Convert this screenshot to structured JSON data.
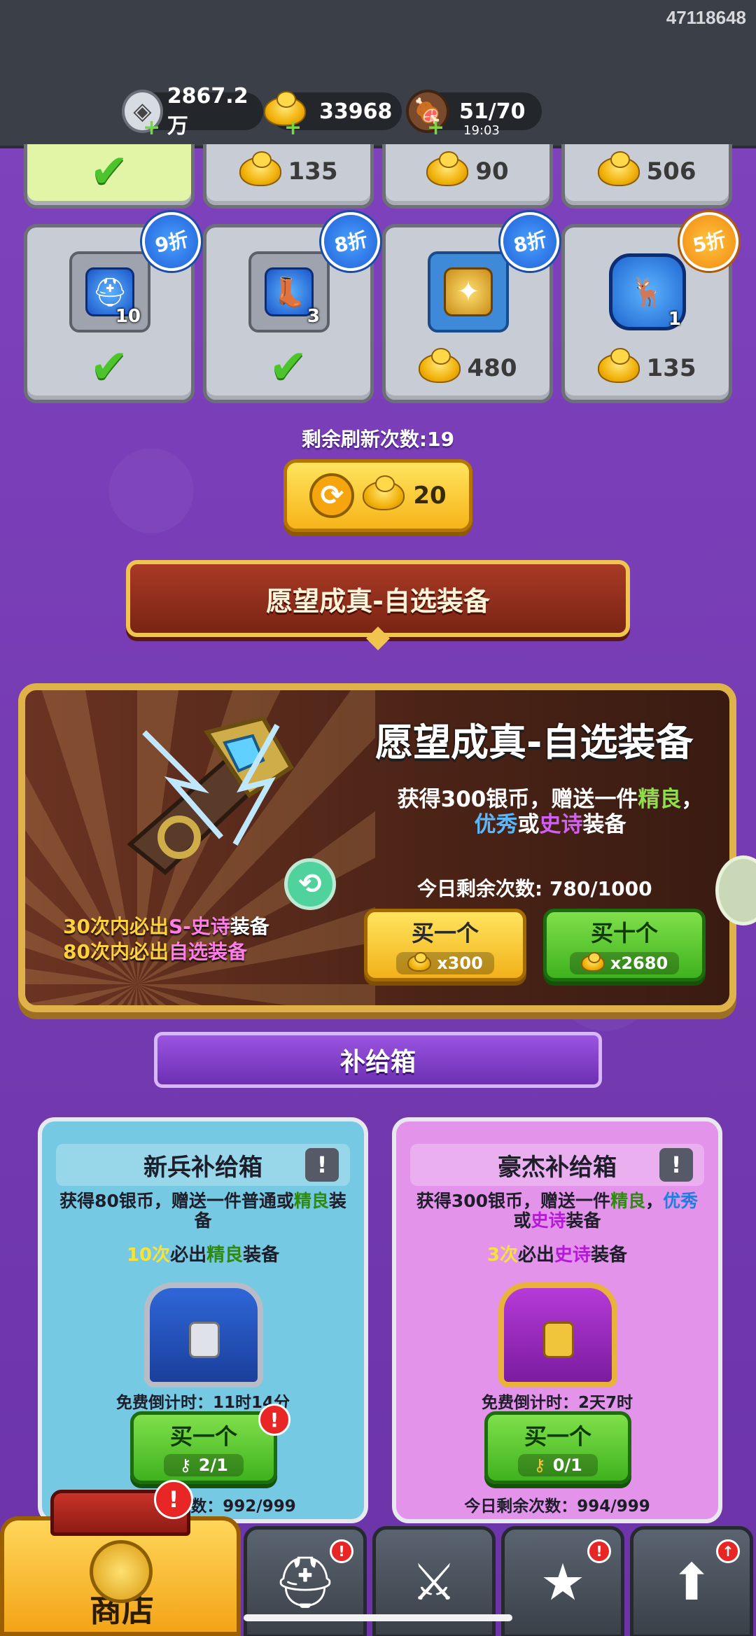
{
  "header": {
    "uid": "47118648",
    "silver": "2867.2万",
    "gold": "33968",
    "stamina": "51/70",
    "stamina_timer": "19:03"
  },
  "shop_row_top": [
    {
      "state": "purchased"
    },
    {
      "price": "135"
    },
    {
      "price": "90"
    },
    {
      "price": "506"
    }
  ],
  "shop_row_main": [
    {
      "discount": "9折",
      "count": "10",
      "icon": "helmet-icon",
      "state": "purchased"
    },
    {
      "discount": "8折",
      "count": "3",
      "icon": "boots-icon",
      "state": "purchased"
    },
    {
      "discount": "8折",
      "icon": "amulet-icon",
      "price": "480"
    },
    {
      "discount": "5折",
      "count": "1",
      "icon": "deer-emblem-icon",
      "price": "135"
    }
  ],
  "refresh": {
    "label": "剩余刷新次数:19",
    "cost": "20"
  },
  "wish": {
    "ribbon_title": "愿望成真-自选装备",
    "title": "愿望成真-自选装备",
    "desc_a": "获得300银币，赠送一件",
    "desc_green": "精良",
    "desc_b": "，",
    "desc_blue": "优秀",
    "desc_c": "或",
    "desc_purple": "史诗",
    "desc_d": "装备",
    "remain": "今日剩余次数:  780/1000",
    "note1_a": "30次内必出",
    "note1_b": "S-史诗",
    "note1_c": "装备",
    "note2_a": "80次内必出",
    "note2_b": "自选装备",
    "buy_one": "买一个",
    "buy_one_cost": "x300",
    "buy_ten": "买十个",
    "buy_ten_cost": "x2680"
  },
  "supply": {
    "title": "补给箱",
    "boxes": [
      {
        "title": "新兵补给箱",
        "desc_a": "获得80银币，赠送一件普通或",
        "desc_green": "精良",
        "desc_b": "装备",
        "guar_a": "10次",
        "guar_b": "必出",
        "guar_c": "精良",
        "guar_d": "装备",
        "timer": "免费倒计时：11时14分",
        "buy": "买一个",
        "keys": "2/1",
        "remain": "今日剩余次数：992/999"
      },
      {
        "title": "豪杰补给箱",
        "desc_a": "获得300银币，赠送一件",
        "desc_green": "精良",
        "desc_b": "，",
        "desc_blue": "优秀",
        "desc_c": "或",
        "desc_purple": "史诗",
        "desc_d": "装备",
        "guar_a": "3次",
        "guar_b": "必出",
        "guar_c": "史诗",
        "guar_d": "装备",
        "timer": "免费倒计时：2天7时",
        "buy": "买一个",
        "keys": "0/1",
        "remain": "今日剩余次数：994/999"
      }
    ]
  },
  "nav": {
    "shop_label": "商店",
    "tabs": [
      "helmet-tab",
      "sword-shield-tab",
      "hero-stars-tab",
      "upgrade-tab"
    ]
  },
  "colors": {
    "background": "#7a3fb8",
    "accent_gold": "#f2b20c",
    "confirm_green": "#3fb21e",
    "alert_red": "#e82626"
  }
}
